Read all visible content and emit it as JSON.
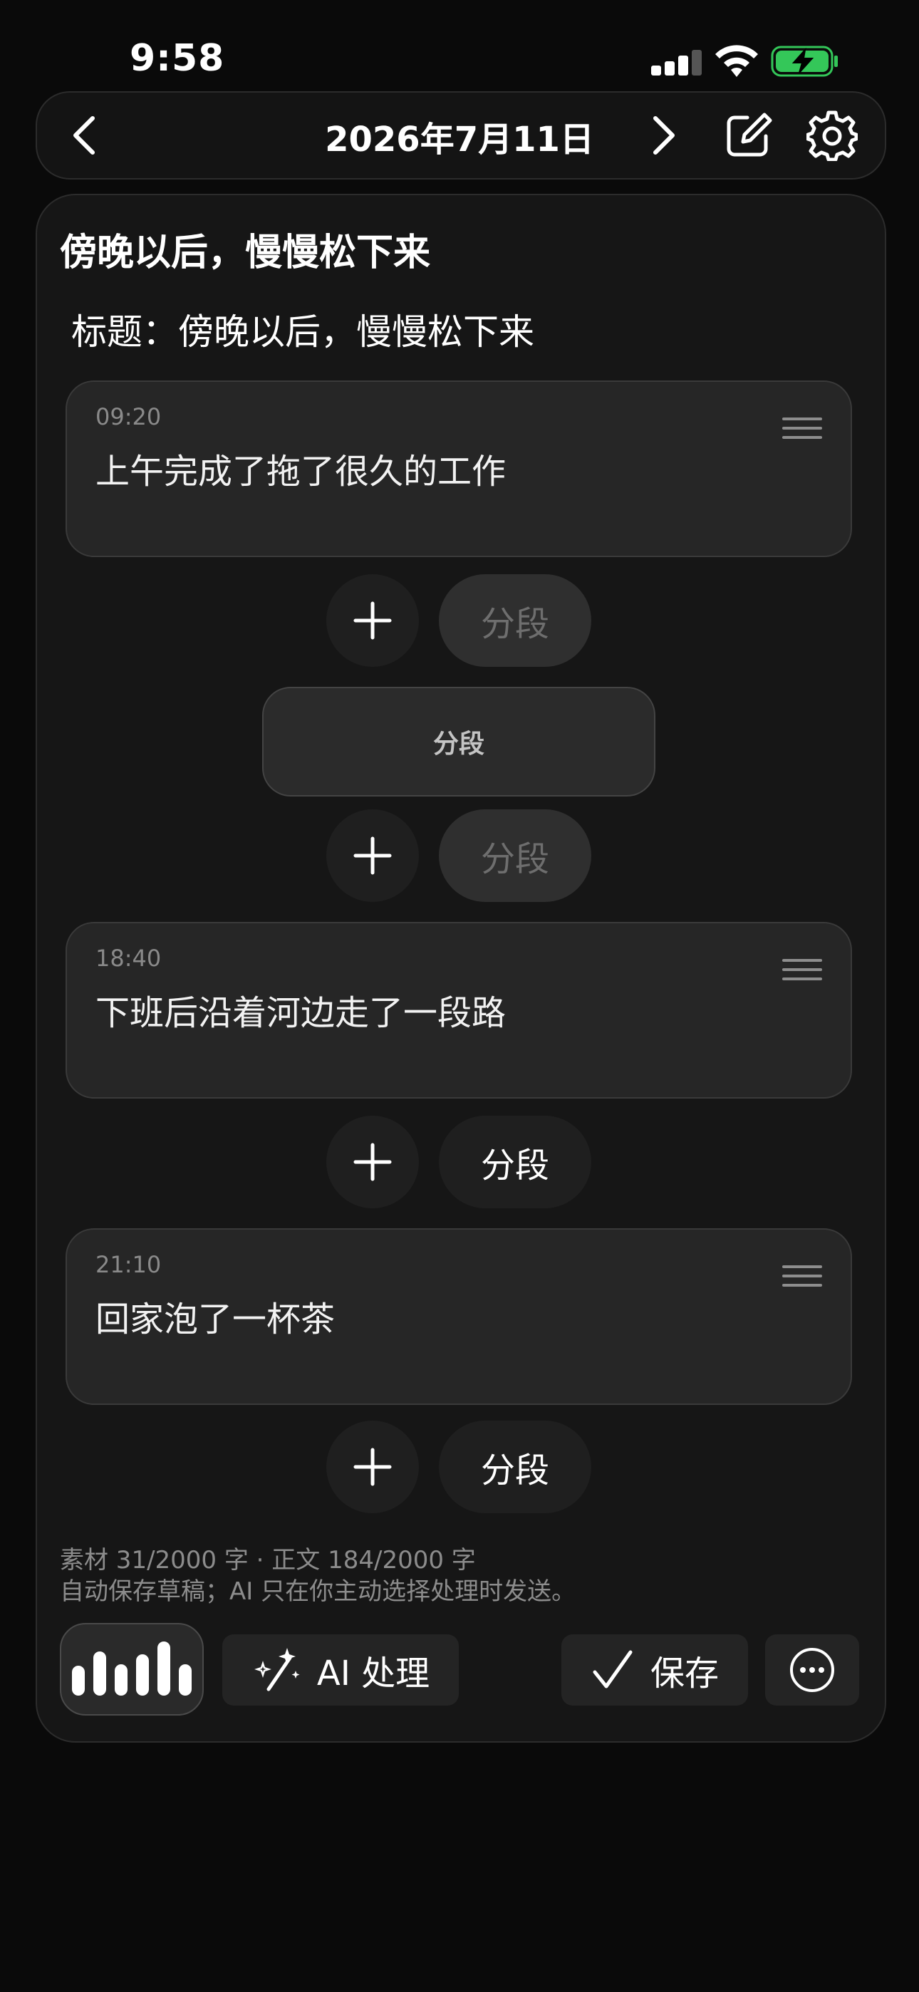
{
  "status_bar": {
    "time": "9:58"
  },
  "nav": {
    "date": "2026年7月11日"
  },
  "main": {
    "title": "傍晚以后，慢慢松下来",
    "subtitle": "标题：傍晚以后，慢慢松下来"
  },
  "entries": [
    {
      "time": "09:20",
      "text": "上午完成了拖了很久的工作"
    },
    {
      "time": "18:40",
      "text": "下班后沿着河边走了一段路"
    },
    {
      "time": "21:10",
      "text": "回家泡了一杯茶"
    }
  ],
  "segment_marker": {
    "label": "分段"
  },
  "actions": {
    "segment_label": "分段"
  },
  "footer": {
    "counts": "素材 31/2000 字 · 正文 184/2000 字",
    "note": "自动保存草稿；AI 只在你主动选择处理时发送。",
    "ai_label": "AI 处理",
    "save_label": "保存"
  },
  "colors": {
    "battery": "#34c759",
    "background": "#0a0a0a",
    "card": "#161616"
  }
}
